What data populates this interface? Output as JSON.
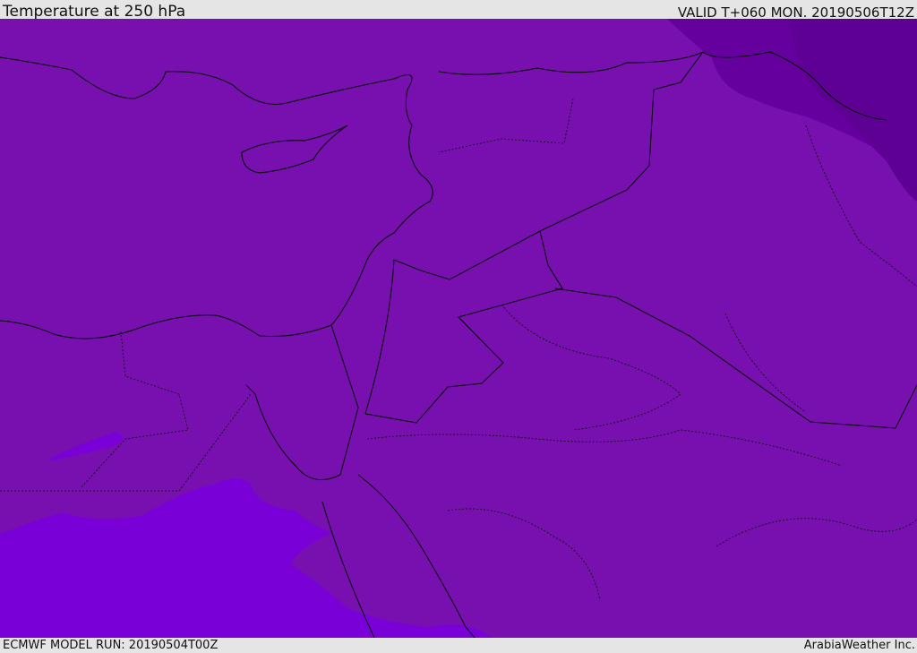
{
  "header": {
    "title": "Temperature at 250 hPa",
    "valid": "VALID T+060 MON. 20190506T12Z"
  },
  "footer": {
    "model_run": "ECMWF MODEL RUN: 20190504T00Z",
    "credit": "ArabiaWeather Inc."
  },
  "colors": {
    "base": "#7810b0",
    "cold": "#62009a",
    "colder": "#5c0092",
    "warm": "#7a00d8",
    "border": "#000000"
  }
}
